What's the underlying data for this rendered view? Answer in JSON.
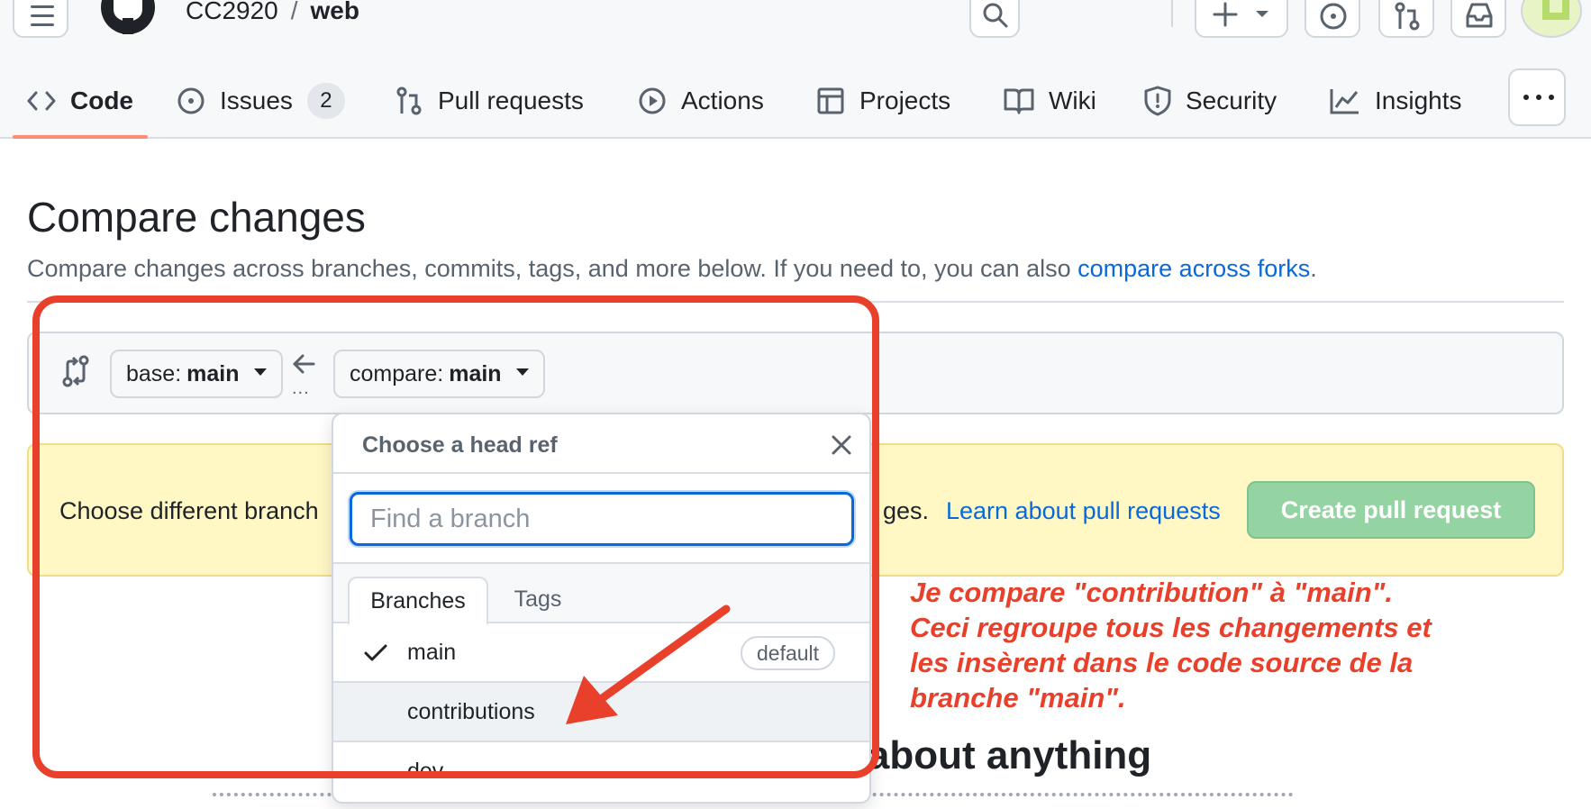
{
  "header": {
    "owner": "CC2920",
    "separator": "/",
    "repo": "web"
  },
  "nav": {
    "tabs": [
      {
        "label": "Code",
        "icon": "code-icon"
      },
      {
        "label": "Issues",
        "icon": "issue-opened-icon",
        "counter": "2"
      },
      {
        "label": "Pull requests",
        "icon": "git-pull-request-icon"
      },
      {
        "label": "Actions",
        "icon": "play-icon"
      },
      {
        "label": "Projects",
        "icon": "table-icon"
      },
      {
        "label": "Wiki",
        "icon": "book-icon"
      },
      {
        "label": "Security",
        "icon": "shield-icon"
      },
      {
        "label": "Insights",
        "icon": "graph-icon"
      }
    ]
  },
  "compare": {
    "title": "Compare changes",
    "description": "Compare changes across branches, commits, tags, and more below. If you need to, you can also ",
    "forks_link": "compare across forks",
    "period": ".",
    "base_prefix": "base: ",
    "base_value": "main",
    "compare_prefix": "compare: ",
    "compare_value": "main",
    "dots": "..."
  },
  "flash": {
    "text": "Choose different branch",
    "tail": "ges.",
    "link": "Learn about pull requests",
    "create_button": "Create pull request"
  },
  "dropdown": {
    "title": "Choose a head ref",
    "filter_placeholder": "Find a branch",
    "tabs": [
      "Branches",
      "Tags"
    ],
    "items": [
      {
        "name": "main",
        "selected": true,
        "label": "default"
      },
      {
        "name": "contributions",
        "selected": false
      },
      {
        "name": "dev",
        "selected": false
      }
    ]
  },
  "discussion": {
    "title": "t about anything"
  },
  "annotation": {
    "lines": [
      "Je compare \"contribution\" à \"main\".",
      "Ceci regroupe tous les changements et",
      "les insèrent dans le code source de la",
      "branche \"main\"."
    ],
    "color": "#e8402b"
  },
  "colors": {
    "accent": "#0969da",
    "tab_underline": "#fd8c73",
    "flash_bg": "#fff8c5",
    "create_button_bg": "#94d3a2"
  }
}
